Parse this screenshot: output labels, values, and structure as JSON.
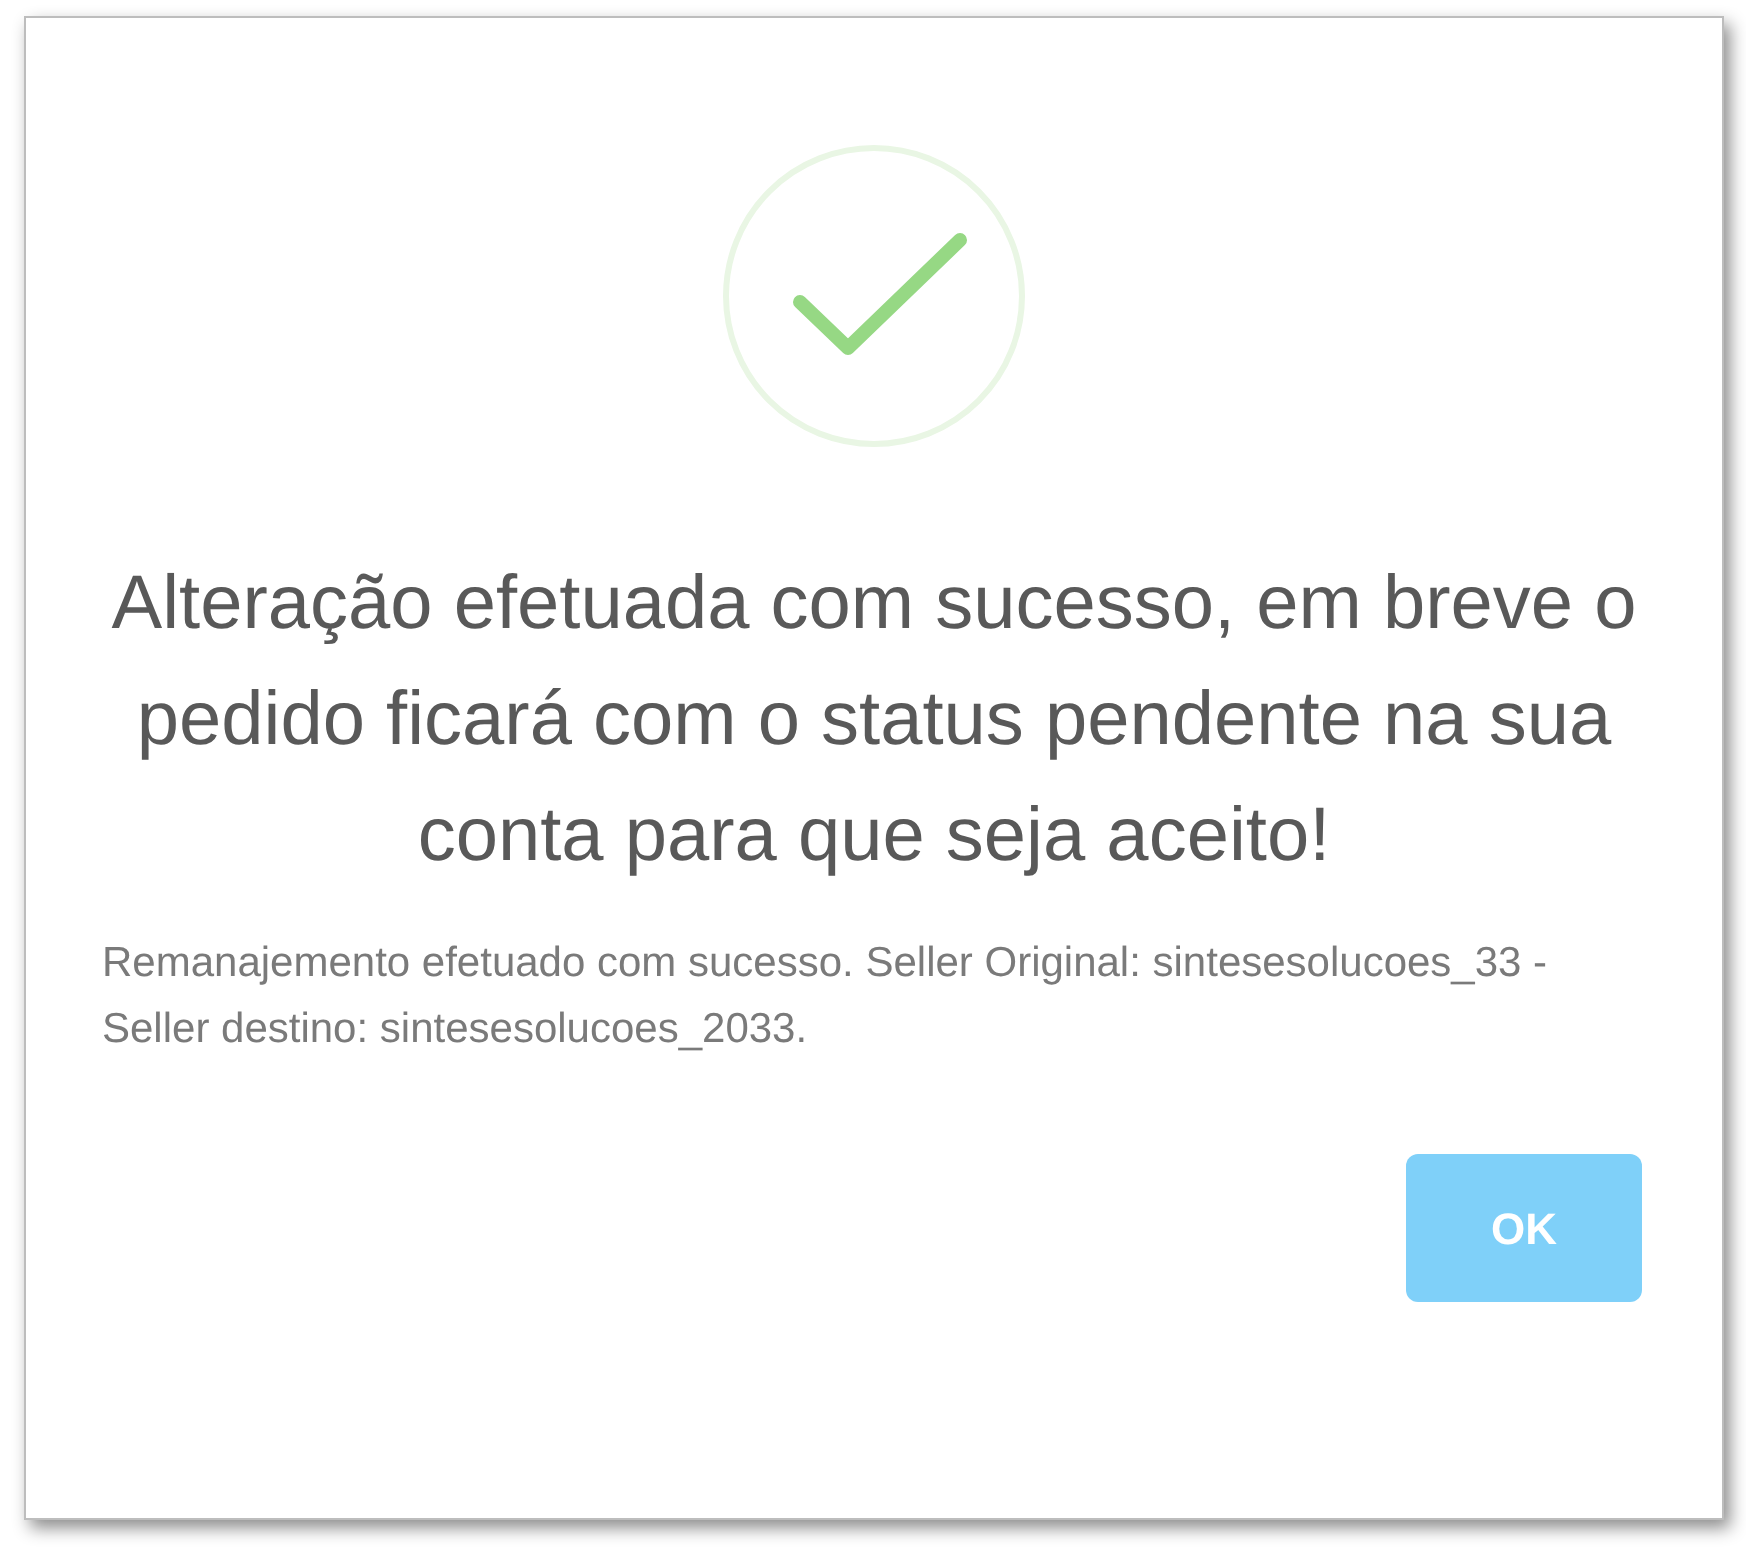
{
  "dialog": {
    "icon": {
      "kind": "success"
    },
    "title": "Alteração efetuada com sucesso, em breve o pedido ficará com o status pendente na sua conta para que seja aceito!",
    "message": "Remanajemento efetuado com sucesso. Seller Original: sintesesolucoes_33 -Seller destino: sintesesolucoes_2033.",
    "buttons": [
      {
        "label": "OK"
      }
    ]
  }
}
